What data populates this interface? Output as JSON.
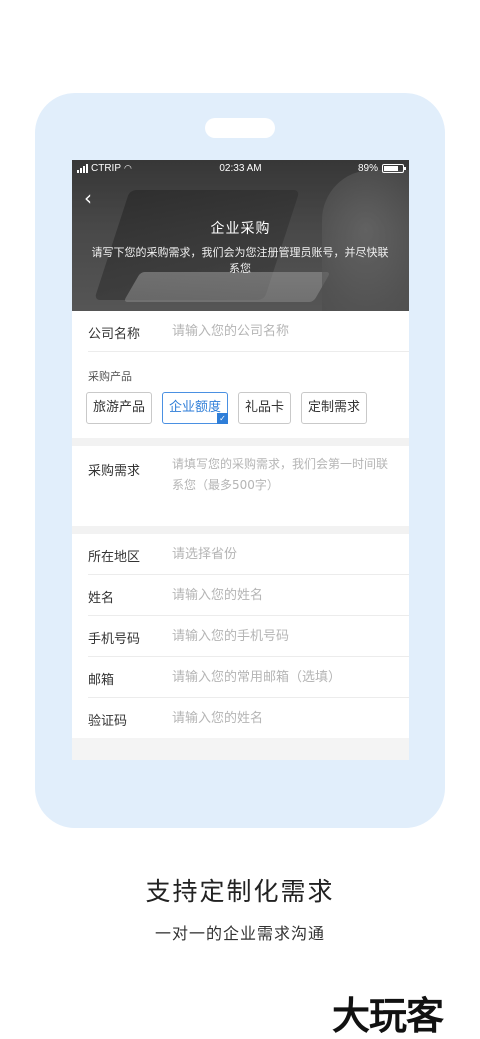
{
  "status_bar": {
    "carrier": "CTRIP",
    "time": "02:33 AM",
    "battery": "89%"
  },
  "header": {
    "back_icon": "chevron-left-icon",
    "title": "企业采购",
    "description": "请写下您的采购需求，我们会为您注册管理员账号，并尽快联系您"
  },
  "form": {
    "company": {
      "label": "公司名称",
      "placeholder": "请输入您的公司名称"
    },
    "products": {
      "label": "采购产品",
      "options": [
        {
          "label": "旅游产品",
          "selected": false
        },
        {
          "label": "企业额度",
          "selected": true
        },
        {
          "label": "礼品卡",
          "selected": false
        },
        {
          "label": "定制需求",
          "selected": false
        }
      ]
    },
    "requirement": {
      "label": "采购需求",
      "placeholder": "请填写您的采购需求，我们会第一时间联系您（最多500字）"
    },
    "region": {
      "label": "所在地区",
      "placeholder": "请选择省份"
    },
    "name": {
      "label": "姓名",
      "placeholder": "请输入您的姓名"
    },
    "phone": {
      "label": "手机号码",
      "placeholder": "请输入您的手机号码"
    },
    "email": {
      "label": "邮箱",
      "placeholder": "请输入您的常用邮箱（选填）"
    },
    "captcha": {
      "label": "验证码",
      "placeholder": "请输入您的姓名"
    }
  },
  "caption": {
    "title": "支持定制化需求",
    "subtitle": "一对一的企业需求沟通"
  },
  "watermark": "大玩客",
  "colors": {
    "frame": "#e1eefb",
    "accent": "#2f7ed8"
  }
}
